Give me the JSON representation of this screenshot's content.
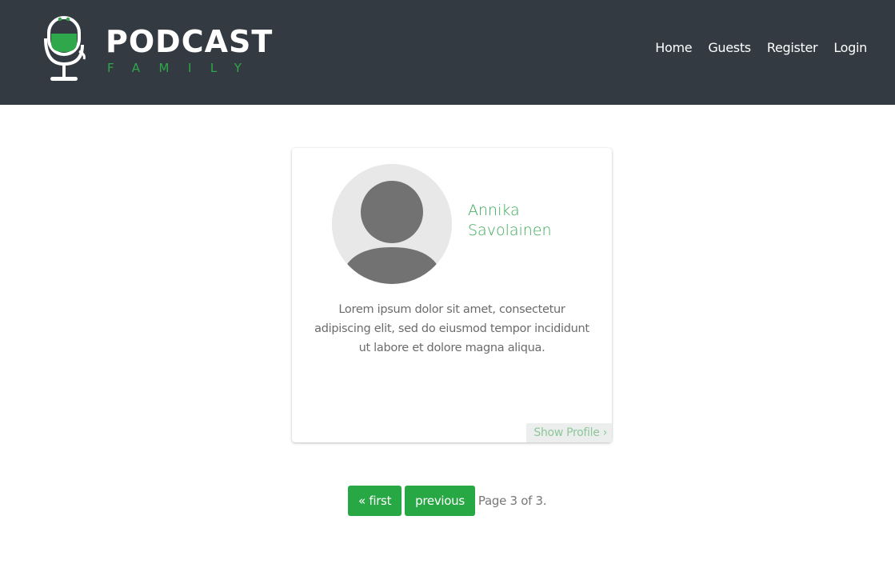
{
  "header": {
    "logo": {
      "word": "PODCAST",
      "sub": "FAMILY"
    },
    "nav": [
      {
        "label": "Home"
      },
      {
        "label": "Guests"
      },
      {
        "label": "Register"
      },
      {
        "label": "Login"
      }
    ]
  },
  "guest_card": {
    "name": "Annika Savolainen",
    "bio": "Lorem ipsum dolor sit amet, consectetur adipiscing elit, sed do eiusmod tempor incididunt ut labore et dolore magna aliqua.",
    "show_profile_label": "Show Profile ›"
  },
  "pagination": {
    "first_label": "« first",
    "previous_label": "previous",
    "info": "Page 3 of 3."
  },
  "colors": {
    "header_bg": "#343a42",
    "accent_green": "#28a745",
    "name_green": "#3aa857",
    "show_profile_text": "#8cc79a"
  },
  "icons": {
    "logo": "microphone-cup-logo-icon",
    "avatar": "user-avatar-icon"
  }
}
